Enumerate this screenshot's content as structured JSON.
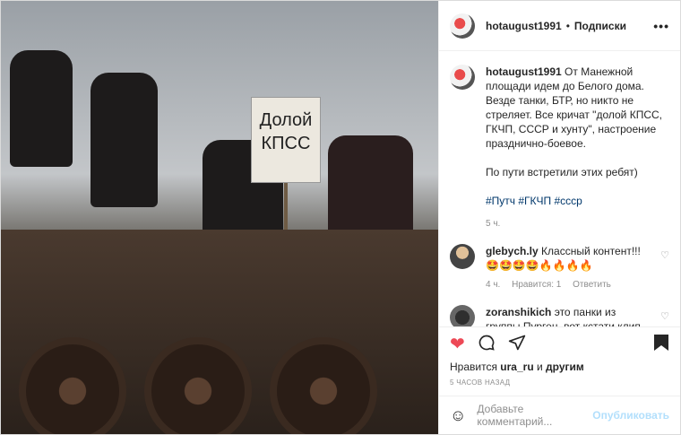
{
  "post": {
    "username": "hotaugust1991",
    "separator": "•",
    "follow_label": "Подписки",
    "more_label": "•••"
  },
  "photo": {
    "sign_text": "Долой КПСС"
  },
  "caption": {
    "username": "hotaugust1991",
    "text": "От Манежной площади идем до Белого дома. Везде танки, БТР, но никто не стреляет. Все кричат \"долой КПСС, ГКЧП, СССР и хунту\", настроение празднично-боевое.",
    "text2": "По пути встретили этих ребят)",
    "tags": "#Путч #ГКЧП #ссср",
    "time": "5 ч."
  },
  "comments": [
    {
      "username": "glebych.ly",
      "text": "Классный контент!!! 🤩🤩🤩🤩🔥🔥🔥🔥",
      "time": "4 ч.",
      "likes": "Нравится: 1",
      "reply": "Ответить"
    },
    {
      "username": "zoranshikich",
      "text": "это панки из группы Пурген, вот кстати клип"
    }
  ],
  "actions": {
    "like_icon": "heart-icon",
    "comment_icon": "comment-icon",
    "share_icon": "share-icon",
    "save_icon": "bookmark-icon"
  },
  "likes": {
    "prefix": "Нравится",
    "user": "ura_ru",
    "conj": "и",
    "others": "другим"
  },
  "posted_ago": "5 ЧАСОВ НАЗАД",
  "add_comment": {
    "placeholder": "Добавьте комментарий...",
    "publish": "Опубликовать"
  },
  "colors": {
    "like": "#ed4956",
    "link": "#00376b",
    "publish": "#b2dffc"
  }
}
